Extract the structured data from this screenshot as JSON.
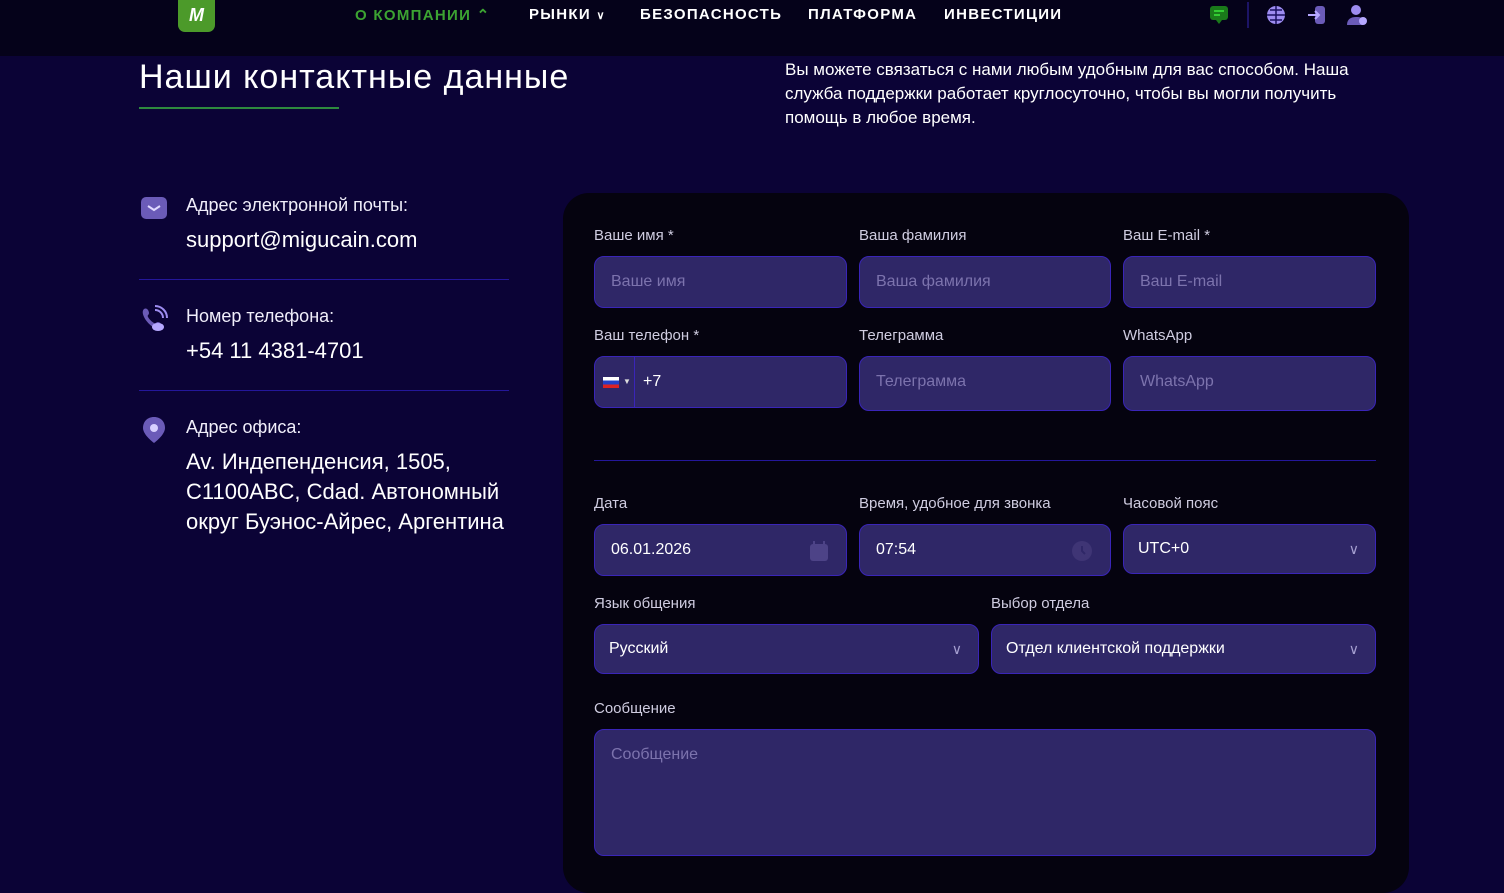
{
  "header": {
    "logo": "M",
    "nav": [
      {
        "label": "О КОМПАНИИ",
        "active": true,
        "chevron": "up"
      },
      {
        "label": "РЫНКИ",
        "chevron": "down"
      },
      {
        "label": "БЕЗОПАСНОСТЬ"
      },
      {
        "label": "ПЛАТФОРМА"
      },
      {
        "label": "ИНВЕСТИЦИИ"
      }
    ],
    "icons": [
      "chat-icon",
      "globe-icon",
      "login-icon",
      "user-icon"
    ]
  },
  "page": {
    "title": "Наши контактные данные",
    "intro": "Вы можете связаться с нами любым удобным для вас способом. Наша служба поддержки работает круглосуточно, чтобы вы могли получить помощь в любое время."
  },
  "contacts": {
    "email_label": "Адрес электронной почты:",
    "email": "support@migucain.com",
    "phone_label": "Номер телефона:",
    "phone": "+54 11 4381-4701",
    "address_label": "Адрес офиса:",
    "address": "Av. Индепенденсия, 1505, C1100ABC, Cdad. Автономный округ Буэнос-Айрес, Аргентина"
  },
  "form": {
    "first_name": {
      "label": "Ваше имя *",
      "placeholder": "Ваше имя"
    },
    "last_name": {
      "label": "Ваша фамилия",
      "placeholder": "Ваша фамилия"
    },
    "email": {
      "label": "Ваш E-mail *",
      "placeholder": "Ваш E-mail"
    },
    "phone": {
      "label": "Ваш телефон *",
      "value": "+7"
    },
    "telegram": {
      "label": "Телеграмма",
      "placeholder": "Телеграмма"
    },
    "whatsapp": {
      "label": "WhatsApp",
      "placeholder": "WhatsApp"
    },
    "date": {
      "label": "Дата",
      "value": "06.01.2026"
    },
    "time": {
      "label": "Время, удобное для звонка",
      "value": "07:54"
    },
    "timezone": {
      "label": "Часовой пояс",
      "value": "UTC+0"
    },
    "language": {
      "label": "Язык общения",
      "value": "Русский"
    },
    "department": {
      "label": "Выбор отдела",
      "value": "Отдел клиентской поддержки"
    },
    "message": {
      "label": "Сообщение",
      "placeholder": "Сообщение"
    }
  },
  "colors": {
    "accent": "#3ca332",
    "input_bg": "#2f2767",
    "page_bg": "#0b0336"
  }
}
